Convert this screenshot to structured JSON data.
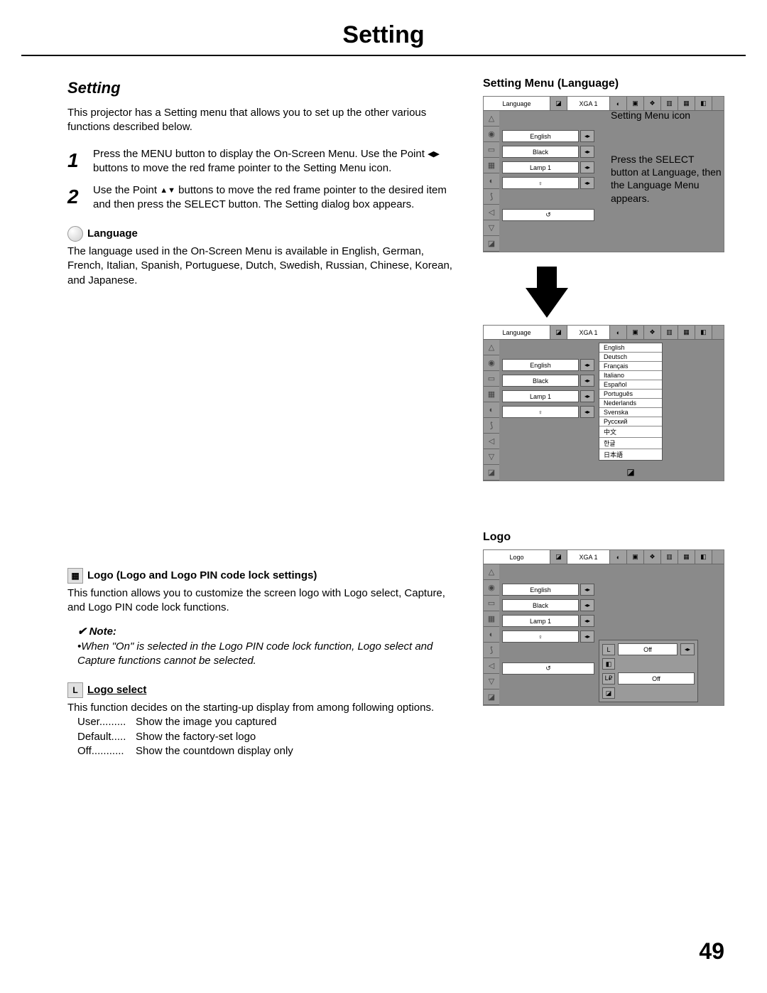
{
  "page_title": "Setting",
  "section_title": "Setting",
  "intro": "This projector has a Setting menu that allows you to set up the other various functions described below.",
  "steps": [
    {
      "num": "1",
      "text_a": "Press the MENU button to display the On-Screen Menu. Use the Point ",
      "text_b": " buttons to move the red frame pointer to the Setting Menu icon."
    },
    {
      "num": "2",
      "text_a": "Use the Point ",
      "text_b": " buttons to move the red frame pointer to the desired item and then press the SELECT button. The Setting dialog box appears."
    }
  ],
  "lr_arrows": "◀▶",
  "ud_arrows": "▲▼",
  "language_heading": "Language",
  "language_para": "The language used in the On-Screen Menu is available in English, German, French, Italian, Spanish, Portuguese, Dutch, Swedish, Russian, Chinese, Korean, and Japanese.",
  "right_heading_1": "Setting Menu (Language)",
  "callout_icon": "Setting Menu icon",
  "callout_select": "Press the SELECT button at Language, then the Language Menu appears.",
  "osd_top_label_language": "Language",
  "osd_top_label_logo": "Logo",
  "osd_top_xga": "XGA 1",
  "osd_field_english": "English",
  "osd_field_black": "Black",
  "osd_field_lamp1": "Lamp 1",
  "osd_field_off": "Off",
  "languages": [
    "English",
    "Deutsch",
    "Français",
    "Italiano",
    "Español",
    "Português",
    "Nederlands",
    "Svenska",
    "Русский",
    "中文",
    "한글",
    "日本語"
  ],
  "logo_heading": "Logo (Logo and Logo PIN code lock settings)",
  "logo_para": "This function allows you to customize the screen logo with Logo select, Capture, and Logo PIN code lock functions.",
  "note_label": "Note:",
  "note_text": "•When \"On\" is selected in the Logo PIN code lock function, Logo select and Capture functions cannot be selected.",
  "logo_select_heading": "Logo select",
  "logo_select_para": "This function decides on the starting-up display from among following options.",
  "logo_options": [
    {
      "term": "User",
      "dots": ".........",
      "desc": "Show the image you captured"
    },
    {
      "term": "Default",
      "dots": ".....",
      "desc": "Show the factory-set logo"
    },
    {
      "term": "Off",
      "dots": "...........",
      "desc": "Show the countdown display only"
    }
  ],
  "right_heading_2": "Logo",
  "page_number": "49"
}
